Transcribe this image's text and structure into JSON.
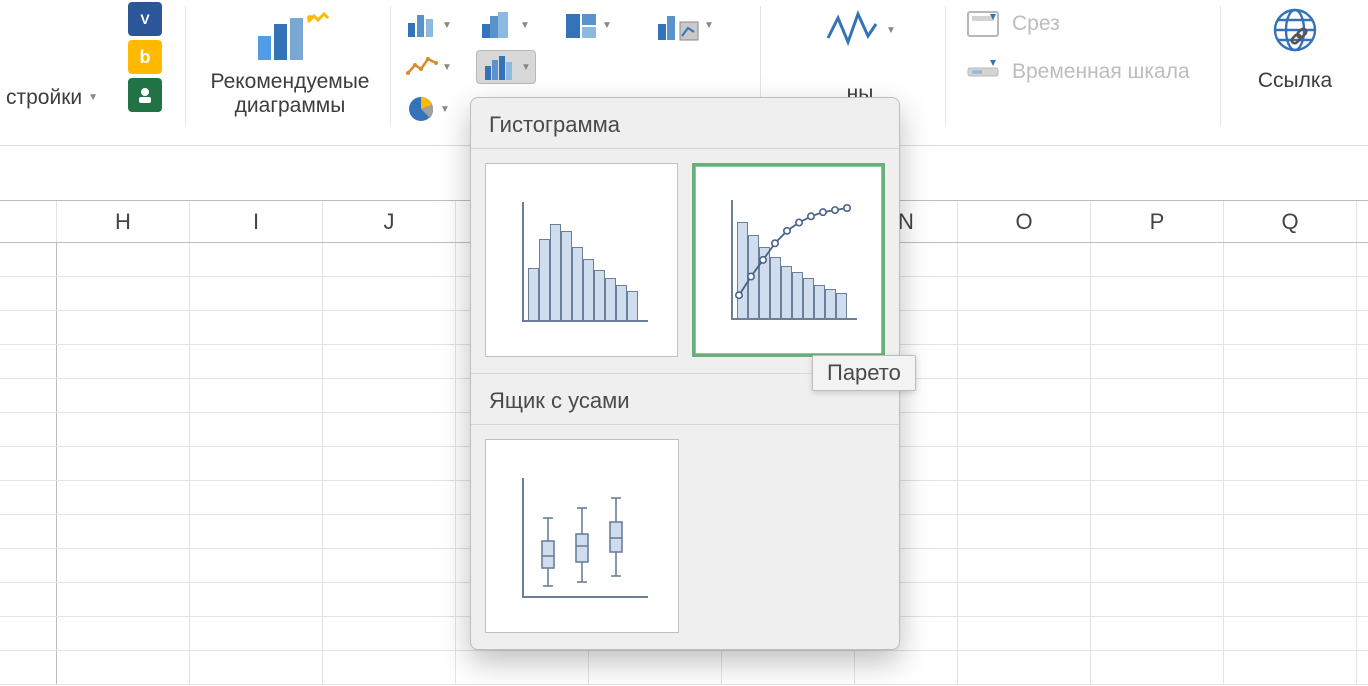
{
  "ribbon": {
    "addins_button": "стройки",
    "recommended_charts": "Рекомендуемые\nдиаграммы",
    "sparklines_suffix": "ны",
    "slicer": "Срез",
    "timeline": "Временная шкала",
    "link": "Ссылка"
  },
  "gallery": {
    "section_histogram": "Гистограмма",
    "section_boxwhisker": "Ящик с усами",
    "tooltip_pareto": "Парето"
  },
  "columns": [
    "",
    "H",
    "I",
    "J",
    "",
    "",
    "",
    "N",
    "O",
    "P",
    "Q"
  ],
  "chart_data": {
    "type": "bar",
    "comment": "Icon previews – approximate shape only",
    "histogram_bars": [
      50,
      78,
      92,
      85,
      70,
      58,
      48,
      40,
      34,
      28
    ],
    "pareto_bars": [
      92,
      80,
      68,
      58,
      50,
      44,
      38,
      32,
      28,
      24
    ],
    "pareto_line_y": [
      20,
      38,
      54,
      70,
      82,
      90,
      96,
      100,
      102,
      104
    ],
    "box_whisker": [
      {
        "min": 10,
        "q1": 28,
        "median": 40,
        "q3": 55,
        "max": 78
      },
      {
        "min": 14,
        "q1": 34,
        "median": 50,
        "q3": 62,
        "max": 88
      },
      {
        "min": 20,
        "q1": 44,
        "median": 58,
        "q3": 74,
        "max": 98
      }
    ]
  }
}
